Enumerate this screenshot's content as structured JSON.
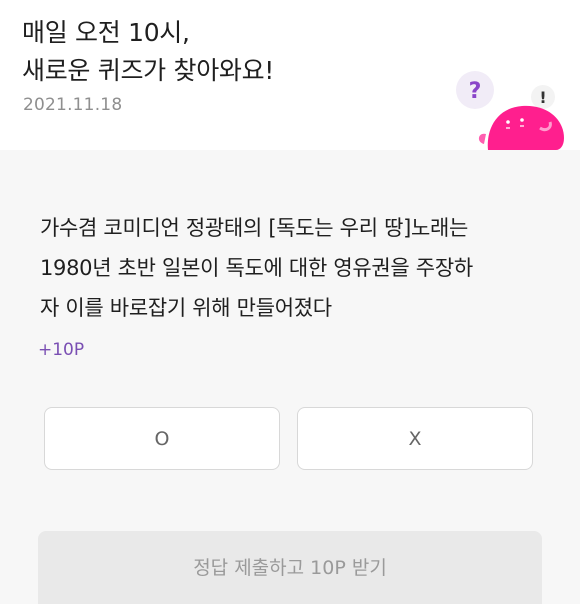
{
  "header": {
    "title_line1": "매일 오전 10시,",
    "title_line2": "새로운 퀴즈가 찾아와요!",
    "date": "2021.11.18"
  },
  "mascot": {
    "bubble_question": "?",
    "bubble_exclaim": "!",
    "color": "#ff1f8e",
    "bubble_question_color": "#8a45c9"
  },
  "quiz": {
    "question_lines": [
      "가수겸 코미디언 정광태의 [독도는 우리 땅]노래는",
      "1980년 초반 일본이 독도에 대한 영유권을 주장하",
      "자 이를 바로잡기 위해 만들어졌다"
    ],
    "points": "+10P",
    "option_o": "O",
    "option_x": "X",
    "submit_label": "정답 제출하고 10P 받기"
  }
}
